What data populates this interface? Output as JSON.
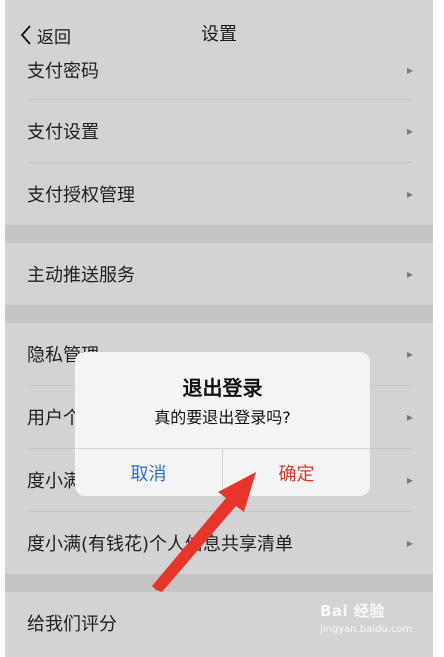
{
  "navbar": {
    "back_label": "返回",
    "title": "设置"
  },
  "rows": [
    {
      "label": "支付密码"
    },
    {
      "label": "支付设置"
    },
    {
      "label": "支付授权管理"
    },
    {
      "label": "主动推送服务"
    },
    {
      "label": "隐私管理"
    },
    {
      "label": "用户个"
    },
    {
      "label": "度小满"
    },
    {
      "label": "度小满(有钱花)个人信息共享清单"
    },
    {
      "label": "给我们评分"
    }
  ],
  "dialog": {
    "title": "退出登录",
    "message": "真的要退出登录吗?",
    "cancel_label": "取消",
    "confirm_label": "确定"
  },
  "watermark": {
    "brand": "Bai 经验",
    "url": "jingyan.baidu.com"
  },
  "colors": {
    "screen_bg": "#d3d3d3",
    "cancel_text": "#2a6fd0",
    "confirm_text": "#d33a2f",
    "annotation_arrow": "#e8352a"
  }
}
